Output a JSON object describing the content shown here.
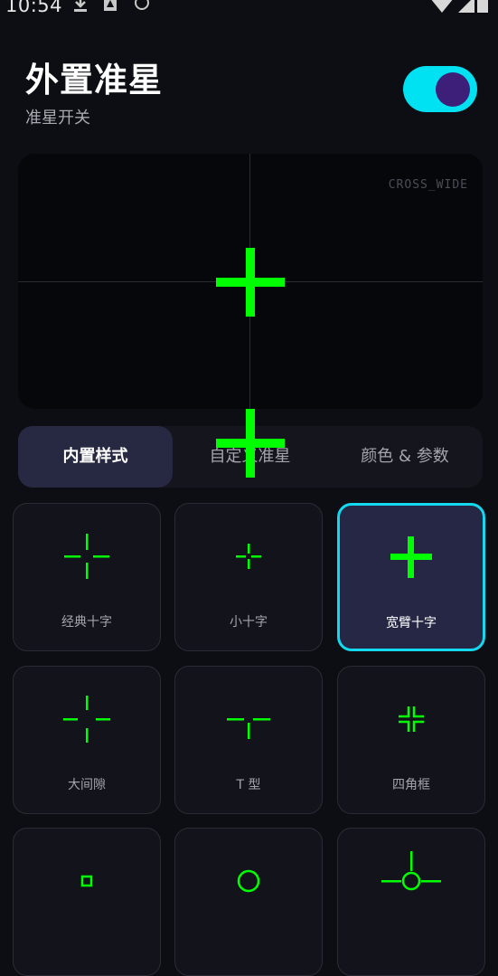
{
  "status_bar": {
    "time": "10:54"
  },
  "header": {
    "title": "外置准星",
    "subtitle": "准星开关",
    "toggle_on": true
  },
  "preview": {
    "style_code": "CROSS_WIDE"
  },
  "tabs": [
    {
      "label": "内置样式",
      "active": true
    },
    {
      "label": "自定义准星",
      "active": false
    },
    {
      "label": "颜色 & 参数",
      "active": false
    }
  ],
  "styles": [
    {
      "label": "经典十字",
      "icon": "classic-cross-icon",
      "selected": false
    },
    {
      "label": "小十字",
      "icon": "small-cross-icon",
      "selected": false
    },
    {
      "label": "宽臂十字",
      "icon": "wide-cross-icon",
      "selected": true
    },
    {
      "label": "大间隙",
      "icon": "large-gap-cross-icon",
      "selected": false
    },
    {
      "label": "T 型",
      "icon": "t-shape-icon",
      "selected": false
    },
    {
      "label": "四角框",
      "icon": "corner-frame-icon",
      "selected": false
    },
    {
      "label": "",
      "icon": "square-dot-icon",
      "selected": false
    },
    {
      "label": "",
      "icon": "circle-icon",
      "selected": false
    },
    {
      "label": "",
      "icon": "circle-cross-icon",
      "selected": false
    }
  ],
  "colors": {
    "accent": "#00e1f2",
    "crosshair": "#00ff00",
    "knob": "#3d1f7a",
    "background": "#0d0e13"
  }
}
